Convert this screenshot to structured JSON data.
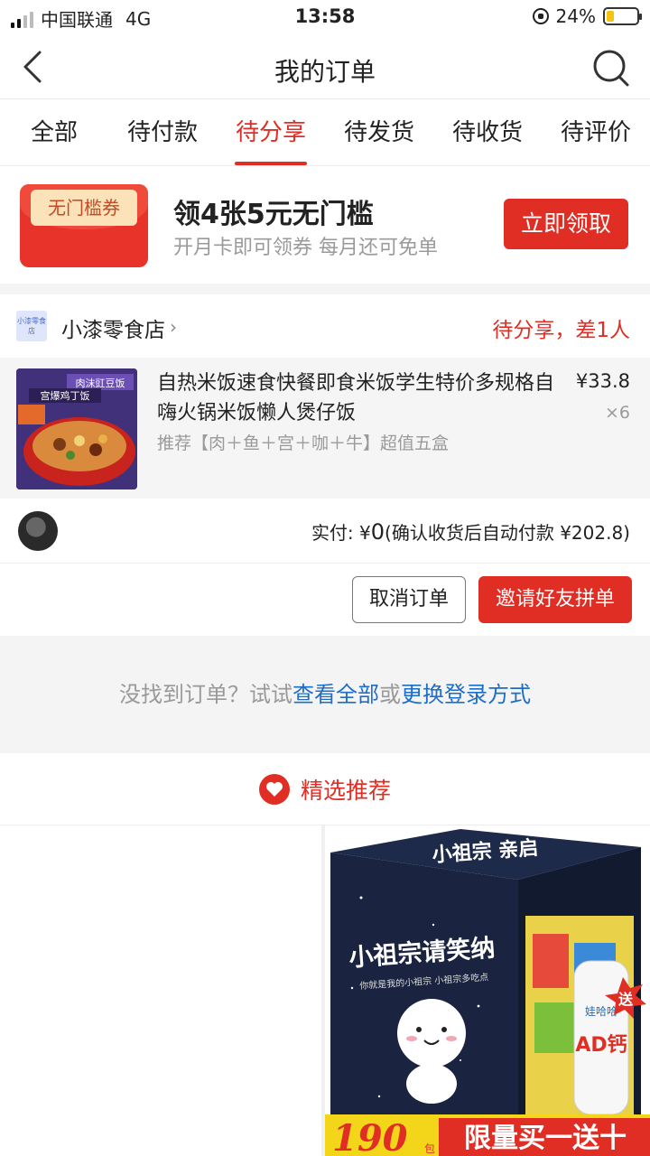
{
  "status_bar": {
    "carrier": "中国联通",
    "network": "4G",
    "time": "13:58",
    "battery": "24%"
  },
  "header": {
    "title": "我的订单"
  },
  "tabs": [
    {
      "label": "全部",
      "active": false
    },
    {
      "label": "待付款",
      "active": false
    },
    {
      "label": "待分享",
      "active": true
    },
    {
      "label": "待发货",
      "active": false
    },
    {
      "label": "待收货",
      "active": false
    },
    {
      "label": "待评价",
      "active": false
    }
  ],
  "promo": {
    "coupon_label": "无门槛券",
    "title": "领4张5元无门槛",
    "subtitle": "开月卡即可领券 每月还可免单",
    "button": "立即领取"
  },
  "order": {
    "shop_logo_text": "小漆零食店",
    "shop_name": "小漆零食店",
    "status": "待分享，差1人",
    "product_name": "自热米饭速食快餐即食米饭学生特价多规格自嗨火锅米饭懒人煲仔饭",
    "product_spec": "推荐【肉＋鱼＋宫＋咖＋牛】超值五盒",
    "thumb_text_1": "肉沫豇豆饭",
    "thumb_text_2": "宫爆鸡丁饭",
    "price": "¥33.8",
    "quantity": "×6",
    "paid_label": "实付: ¥",
    "paid_amount": "0",
    "paid_note": "(确认收货后自动付款 ¥202.8)",
    "cancel_button": "取消订单",
    "invite_button": "邀请好友拼单"
  },
  "not_found": {
    "prefix": "没找到订单？试试",
    "link1": "查看全部",
    "middle": "或",
    "link2": "更换登录方式"
  },
  "recommend": {
    "title": "精选推荐"
  },
  "product_card": {
    "box_title": "小祖宗请笑纳",
    "box_top": "小祖宗 亲启",
    "box_sub": "你就是我的小祖宗  小祖宗多吃点",
    "gift": "送",
    "drink_label": "娃哈哈",
    "drink_ad": "AD钙",
    "price_num": "190",
    "price_unit": "包",
    "promo_text": "限量买一送十"
  },
  "colors": {
    "accent": "#e02e24",
    "link": "#1d6dc9"
  }
}
